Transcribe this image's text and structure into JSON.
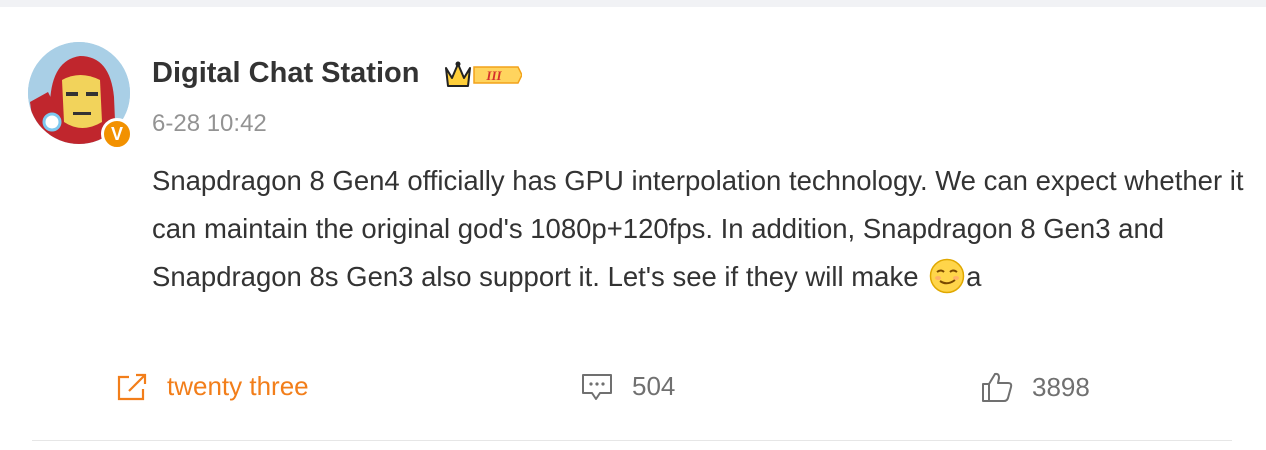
{
  "post": {
    "author": {
      "name": "Digital Chat Station",
      "verified_badge": "V",
      "level_badge": "III"
    },
    "timestamp": "6-28 10:42",
    "text_before_emoji": "Snapdragon 8 Gen4 officially has GPU interpolation technology. We can expect whether it can maintain the original god's 1080p+120fps. In addition, Snapdragon 8 Gen3 and Snapdragon 8s Gen3 also support it. Let's see if they will make ",
    "text_after_emoji": "a",
    "emoji": "smirk-emoji",
    "actions": {
      "repost": {
        "label": "twenty three",
        "icon": "share-icon"
      },
      "comment": {
        "count": "504",
        "icon": "comment-icon"
      },
      "like": {
        "count": "3898",
        "icon": "thumbs-up-icon"
      }
    }
  },
  "colors": {
    "accent": "#f27e1a",
    "text": "#333333",
    "muted": "#939393",
    "badge": "#f29100"
  }
}
